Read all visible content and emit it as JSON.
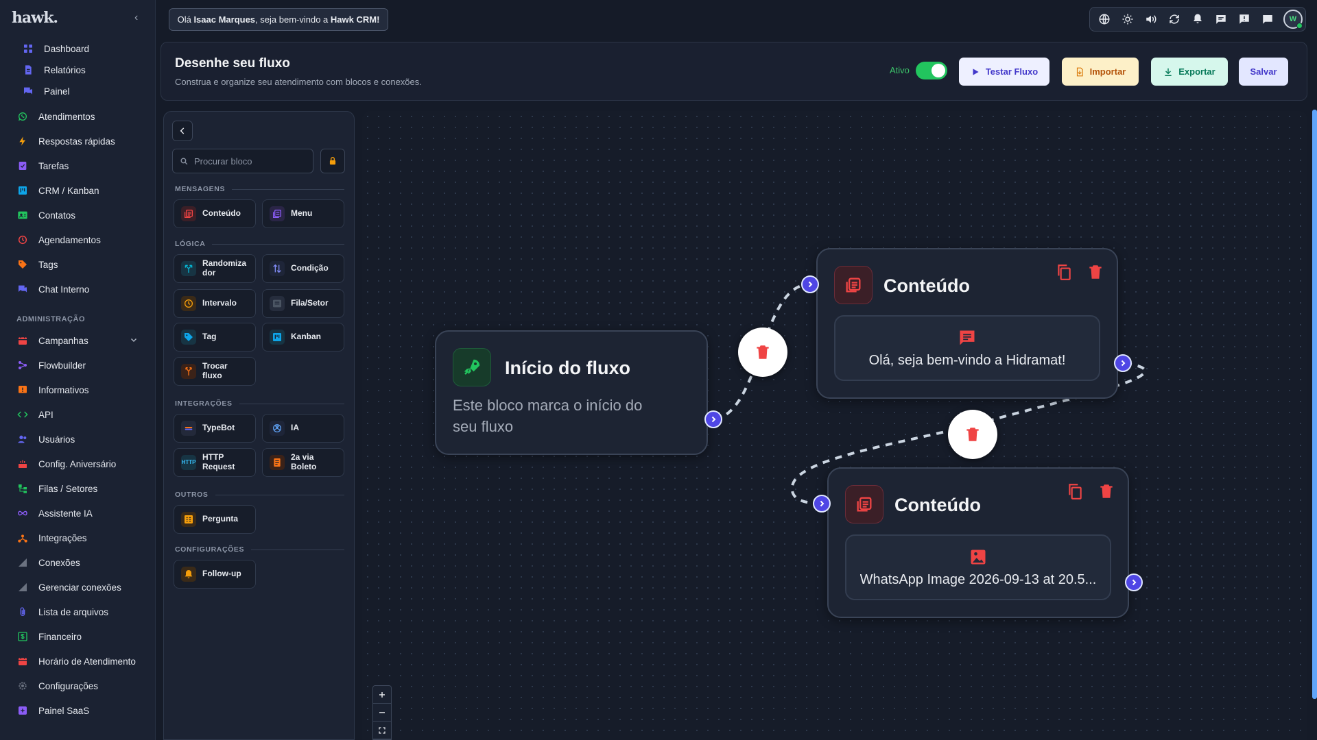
{
  "app": {
    "logo": "hawk."
  },
  "greeting": {
    "prefix": "Olá",
    "user": "Isaac Marques",
    "middle": ", seja bem-vindo a",
    "brand": "Hawk CRM!"
  },
  "sidebar": {
    "items": [
      {
        "label": "Dashboard",
        "icon": "dashboard-icon",
        "color": "#6366f1"
      },
      {
        "label": "Relatórios",
        "icon": "report-icon",
        "color": "#6366f1"
      },
      {
        "label": "Painel",
        "icon": "chat-icon",
        "color": "#6366f1"
      },
      {
        "label": "Atendimentos",
        "icon": "whatsapp-icon",
        "color": "#22c55e"
      },
      {
        "label": "Respostas rápidas",
        "icon": "bolt-icon",
        "color": "#f59e0b"
      },
      {
        "label": "Tarefas",
        "icon": "task-icon",
        "color": "#8b5cf6"
      },
      {
        "label": "CRM / Kanban",
        "icon": "kanban-icon",
        "color": "#0ea5e9"
      },
      {
        "label": "Contatos",
        "icon": "contacts-icon",
        "color": "#22c55e"
      },
      {
        "label": "Agendamentos",
        "icon": "clock-icon",
        "color": "#ef4444"
      },
      {
        "label": "Tags",
        "icon": "tag-icon",
        "color": "#f97316"
      },
      {
        "label": "Chat Interno",
        "icon": "chat-icon",
        "color": "#6366f1"
      }
    ],
    "admin_section": "ADMINISTRAÇÃO",
    "admin_items": [
      {
        "label": "Campanhas",
        "icon": "calendar-icon",
        "color": "#ef4444",
        "expandable": true
      },
      {
        "label": "Flowbuilder",
        "icon": "flow-icon",
        "color": "#8b5cf6"
      },
      {
        "label": "Informativos",
        "icon": "alert-icon",
        "color": "#f97316"
      },
      {
        "label": "API",
        "icon": "code-icon",
        "color": "#22c55e"
      },
      {
        "label": "Usuários",
        "icon": "users-icon",
        "color": "#6366f1"
      },
      {
        "label": "Config. Aniversário",
        "icon": "cake-icon",
        "color": "#ef4444"
      },
      {
        "label": "Filas / Setores",
        "icon": "queue-icon",
        "color": "#22c55e"
      },
      {
        "label": "Assistente IA",
        "icon": "infinity-icon",
        "color": "#8b5cf6"
      },
      {
        "label": "Integrações",
        "icon": "integration-icon",
        "color": "#f97316"
      },
      {
        "label": "Conexões",
        "icon": "signal-icon",
        "color": "#6b7280"
      },
      {
        "label": "Gerenciar conexões",
        "icon": "signal-icon",
        "color": "#6b7280"
      },
      {
        "label": "Lista de arquivos",
        "icon": "attach-icon",
        "color": "#6366f1"
      },
      {
        "label": "Financeiro",
        "icon": "money-icon",
        "color": "#22c55e"
      },
      {
        "label": "Horário de Atendimento",
        "icon": "calendar-icon",
        "color": "#ef4444"
      },
      {
        "label": "Configurações",
        "icon": "gear-icon",
        "color": "#6b7280"
      },
      {
        "label": "Painel SaaS",
        "icon": "saas-icon",
        "color": "#8b5cf6"
      }
    ]
  },
  "header": {
    "title": "Desenhe seu fluxo",
    "subtitle": "Construa e organize seu atendimento com blocos e conexões.",
    "active_label": "Ativo",
    "test_label": "Testar Fluxo",
    "import_label": "Importar",
    "export_label": "Exportar",
    "save_label": "Salvar"
  },
  "panel": {
    "search_placeholder": "Procurar bloco",
    "categories": {
      "messages": "MENSAGENS",
      "logic": "LÓGICA",
      "integrations": "INTEGRAÇÕES",
      "others": "OUTROS",
      "settings": "CONFIGURAÇÕES"
    },
    "blocks": {
      "content": "Conteúdo",
      "menu": "Menu",
      "randomizer_1": "Randomiza",
      "randomizer_2": "dor",
      "condition": "Condição",
      "interval": "Intervalo",
      "queue": "Fila/Setor",
      "tag": "Tag",
      "kanban": "Kanban",
      "switch_1": "Trocar",
      "switch_2": "fluxo",
      "typebot": "TypeBot",
      "ia": "IA",
      "http_1": "HTTP",
      "http_2": "Request",
      "http_badge": "HTTP",
      "boleto_1": "2a via",
      "boleto_2": "Boleto",
      "question": "Pergunta",
      "followup": "Follow-up"
    }
  },
  "canvas": {
    "start_node": {
      "title": "Início do fluxo",
      "description": "Este bloco marca o início do seu fluxo"
    },
    "content_node_1": {
      "title": "Conteúdo",
      "text": "Olá, seja bem-vindo a Hidramat!"
    },
    "content_node_2": {
      "title": "Conteúdo",
      "text": "WhatsApp Image 2026-09-13 at 20.5..."
    }
  },
  "colors": {
    "accent": "#4f46e5",
    "success": "#22c55e",
    "danger": "#ef4444"
  }
}
